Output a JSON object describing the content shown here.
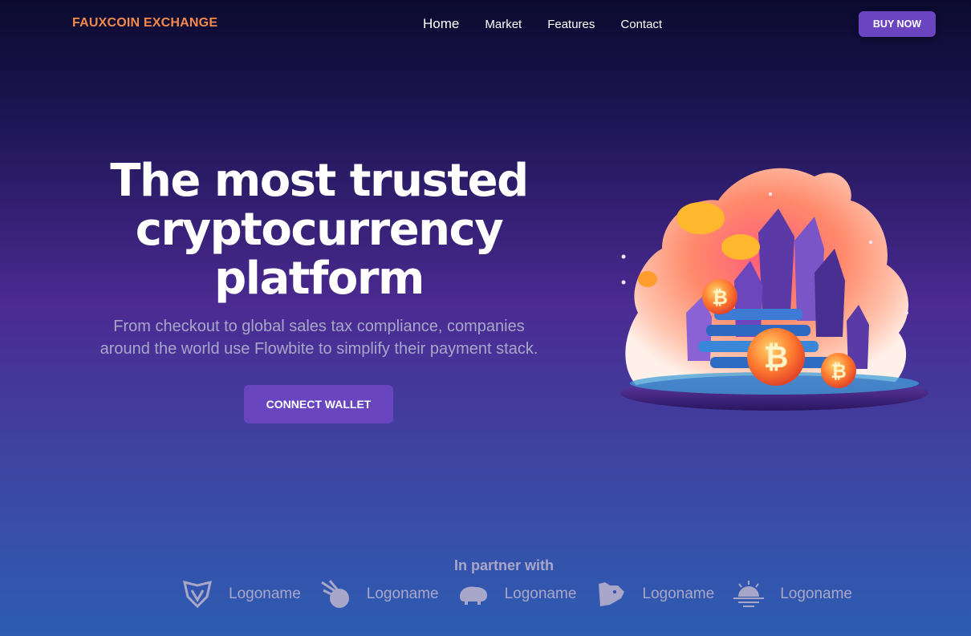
{
  "nav": {
    "brand": "FAUXCOIN EXCHANGE",
    "links": [
      {
        "label": "Home",
        "active": true
      },
      {
        "label": "Market"
      },
      {
        "label": "Features"
      },
      {
        "label": "Contact"
      }
    ],
    "buy_label": "BUY NOW"
  },
  "hero": {
    "title_lines": [
      "The most trusted",
      "cryptocurrency",
      "platform"
    ],
    "subtitle_lines": [
      "From checkout to global sales tax compliance, companies",
      "around the world use Flowbite to simplify their payment stack."
    ],
    "cta_label": "CONNECT WALLET",
    "illustration_icon": "bitcoin-island-illustration"
  },
  "partners": {
    "title": "In partner with",
    "logos": [
      {
        "icon": "shield-icon",
        "name": "Logoname"
      },
      {
        "icon": "comet-icon",
        "name": "Logoname"
      },
      {
        "icon": "bison-icon",
        "name": "Logoname"
      },
      {
        "icon": "bear-icon",
        "name": "Logoname"
      },
      {
        "icon": "sunset-icon",
        "name": "Logoname"
      }
    ]
  },
  "colors": {
    "brand": "#f5894a",
    "accent": "#6b44c2",
    "muted_text": "#a9a7c9"
  }
}
